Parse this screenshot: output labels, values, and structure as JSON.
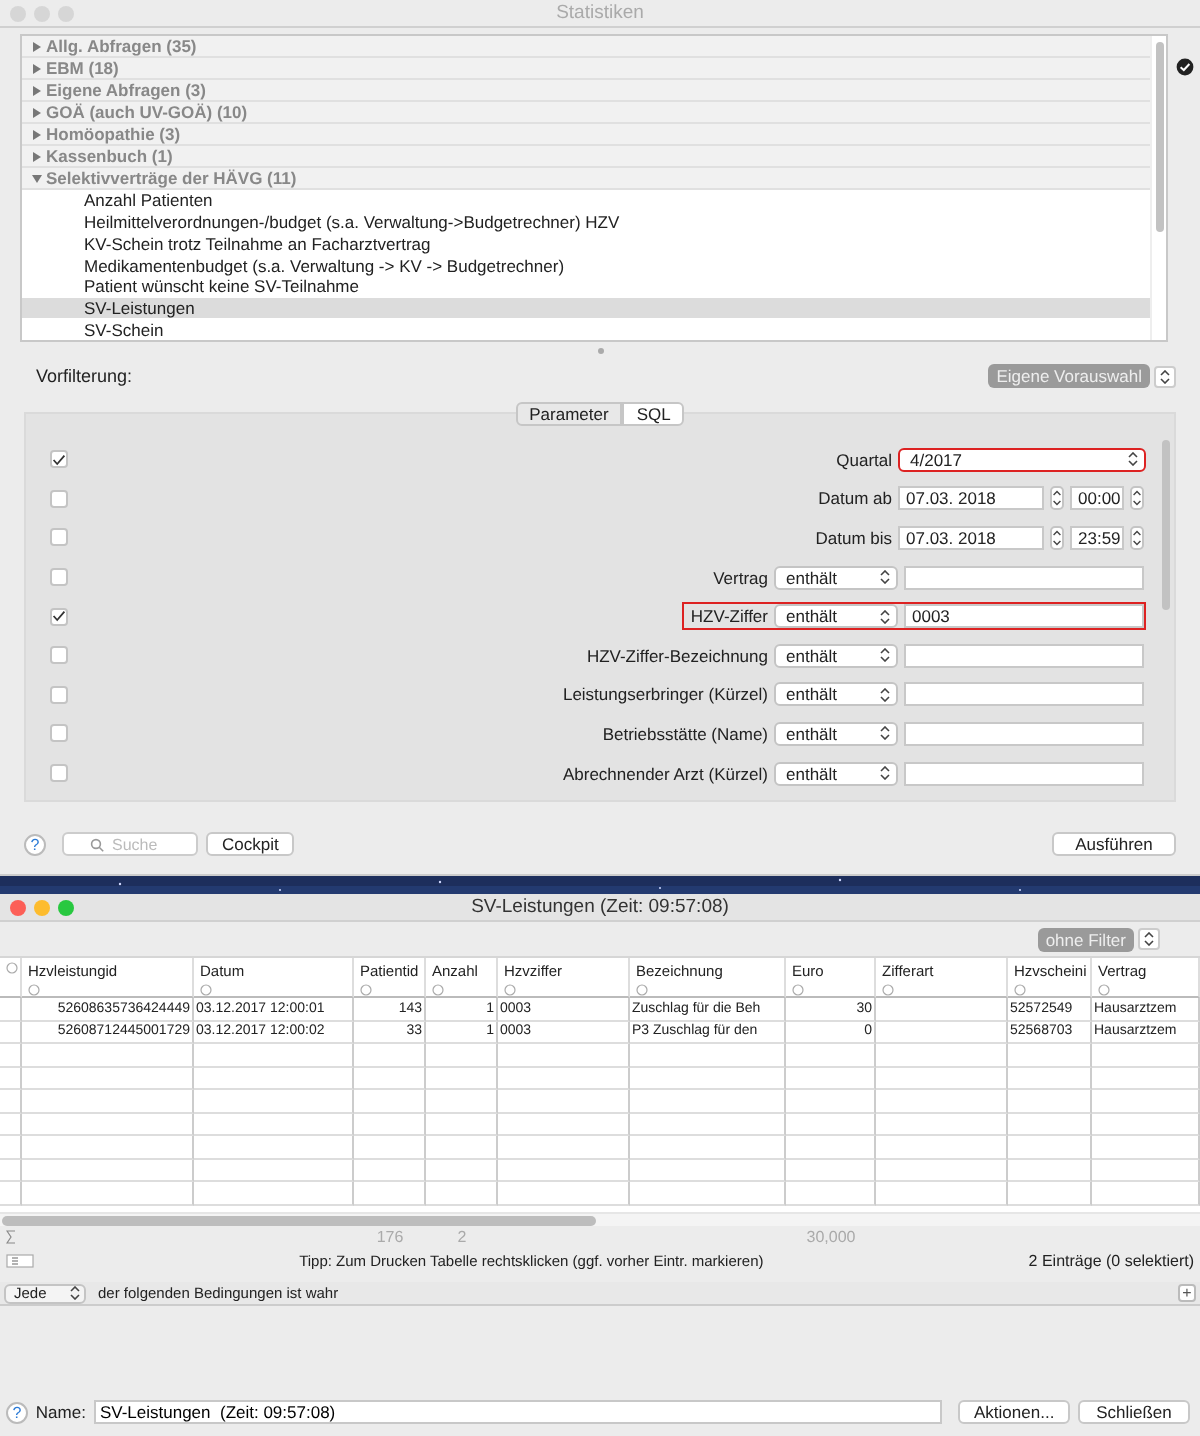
{
  "main_window": {
    "title": "Statistiken"
  },
  "tree": [
    {
      "label": "Allg. Abfragen (35)",
      "expanded": false
    },
    {
      "label": "EBM (18)",
      "expanded": false
    },
    {
      "label": "Eigene Abfragen (3)",
      "expanded": false
    },
    {
      "label": "GOÄ (auch UV-GOÄ) (10)",
      "expanded": false
    },
    {
      "label": "Homöopathie (3)",
      "expanded": false
    },
    {
      "label": "Kassenbuch (1)",
      "expanded": false
    },
    {
      "label": "Selektivverträge der HÄVG (11)",
      "expanded": true,
      "children": [
        {
          "label": "Anzahl Patienten",
          "selected": false
        },
        {
          "label": "Heilmittelverordnungen-/budget (s.a. Verwaltung->Budgetrechner) HZV",
          "selected": false
        },
        {
          "label": "KV-Schein trotz Teilnahme an Facharztvertrag",
          "selected": false
        },
        {
          "label": "Medikamentenbudget (s.a. Verwaltung -> KV -> Budgetrechner)",
          "selected": false
        },
        {
          "label": "Patient wünscht keine SV-Teilnahme",
          "selected": false
        },
        {
          "label": "SV-Leistungen",
          "selected": true
        },
        {
          "label": "SV-Schein",
          "selected": false
        }
      ]
    }
  ],
  "prefilter": {
    "label": "Vorfilterung:",
    "preset": "Eigene Vorauswahl"
  },
  "tabs": [
    {
      "label": "Parameter",
      "selected": true
    },
    {
      "label": "SQL",
      "selected": false
    }
  ],
  "filters": [
    {
      "kind": "select",
      "checked": true,
      "highlighted": true,
      "label": "Quartal",
      "value": "4/2017"
    },
    {
      "kind": "date",
      "checked": false,
      "highlighted": false,
      "label": "Datum ab",
      "date": "07.03. 2018",
      "time": "00:00"
    },
    {
      "kind": "date",
      "checked": false,
      "highlighted": false,
      "label": "Datum bis",
      "date": "07.03. 2018",
      "time": "23:59"
    },
    {
      "kind": "text",
      "checked": false,
      "highlighted": false,
      "label": "Vertrag",
      "operator": "enthält"
    },
    {
      "kind": "text",
      "checked": true,
      "highlighted": true,
      "label": "HZV-Ziffer",
      "operator": "enthält",
      "value": "0003"
    },
    {
      "kind": "text",
      "checked": false,
      "highlighted": false,
      "label": "HZV-Ziffer-Bezeichnung",
      "operator": "enthält"
    },
    {
      "kind": "text",
      "checked": false,
      "highlighted": false,
      "label": "Leistungserbringer (Kürzel)",
      "operator": "enthält"
    },
    {
      "kind": "text",
      "checked": false,
      "highlighted": false,
      "label": "Betriebsstätte (Name)",
      "operator": "enthält"
    },
    {
      "kind": "text",
      "checked": false,
      "highlighted": false,
      "label": "Abrechnender Arzt (Kürzel)",
      "operator": "enthält"
    }
  ],
  "main_footer": {
    "help": "?",
    "search_placeholder": "Suche",
    "buttons": [
      "Cockpit",
      "Ausführen"
    ]
  },
  "result_window": {
    "title": "SV-Leistungen  (Zeit: 09:57:08)",
    "filter": "ohne Filter"
  },
  "table": {
    "columns": [
      {
        "label": "Hzvleistungid"
      },
      {
        "label": "Datum"
      },
      {
        "label": "Patientid",
        "total": "176"
      },
      {
        "label": "Anzahl",
        "total": "2"
      },
      {
        "label": "Hzvziffer"
      },
      {
        "label": "Bezeichnung"
      },
      {
        "label": "Euro",
        "total": "30,000"
      },
      {
        "label": "Zifferart"
      },
      {
        "label": "Hzvscheini"
      },
      {
        "label": "Vertrag"
      }
    ],
    "rows": [
      [
        "52608635736424449",
        "03.12.2017 12:00:01",
        "143",
        "1",
        "0003",
        "Zuschlag für die Beh",
        "30",
        null,
        "52572549",
        "Hausarztzem"
      ],
      [
        "52608712445001729",
        "03.12.2017 12:00:02",
        "33",
        "1",
        "0003",
        "P3 Zuschlag für den",
        "0",
        null,
        "52568703",
        "Hausarztzem"
      ]
    ]
  },
  "summary": {
    "tip": "Tipp: Zum Drucken Tabelle rechtsklicken (ggf. vorher Eintr. markieren)",
    "count": "2 Einträge (0 selektiert)"
  },
  "conditions": {
    "mode": "Jede",
    "text": "der folgenden Bedingungen ist wahr",
    "add": "+"
  },
  "result_footer": {
    "help": "?",
    "name_label": "Name:",
    "name_value": "SV-Leistungen  (Zeit: 09:57:08)",
    "buttons": [
      "Aktionen...",
      "Schließen"
    ]
  }
}
